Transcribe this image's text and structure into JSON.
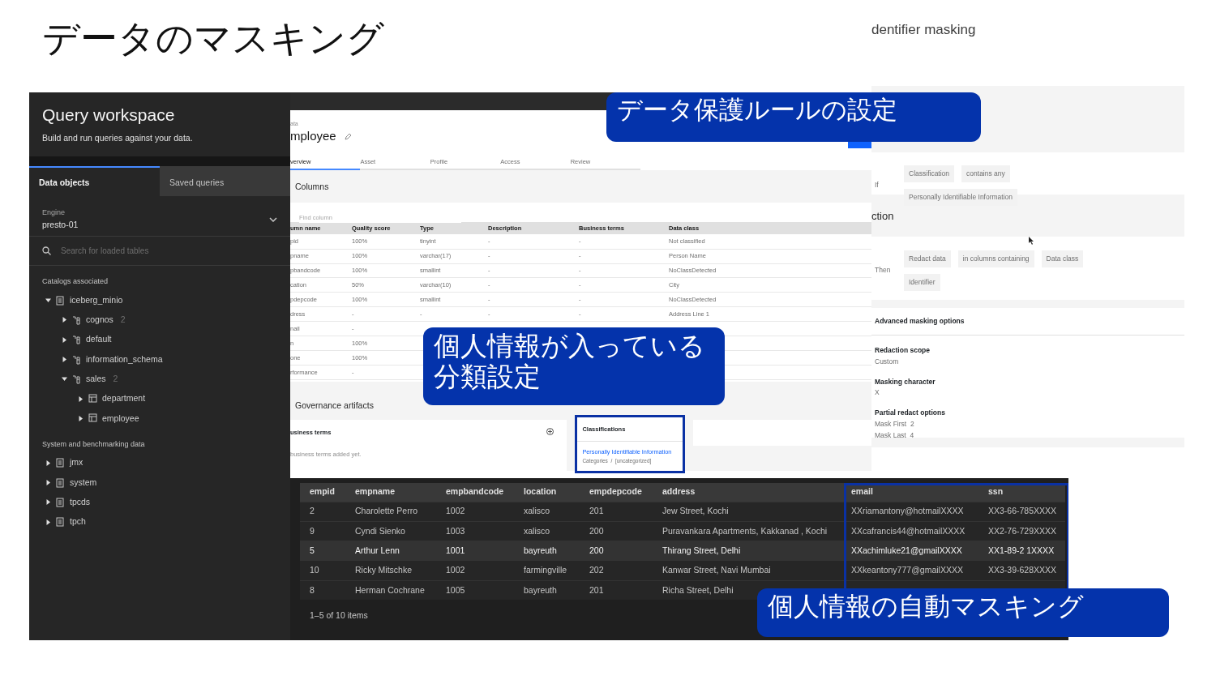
{
  "slide_title": "データのマスキング",
  "query_workspace": {
    "title": "Query workspace",
    "subtitle": "Build and run queries against your data.",
    "tabs": [
      {
        "label": "Data objects",
        "selected": true
      },
      {
        "label": "Saved queries",
        "selected": false
      }
    ],
    "engine_label": "Engine",
    "engine_value": "presto-01",
    "search_placeholder": "Search for loaded tables",
    "sections": [
      {
        "heading": "Catalogs associated",
        "items": [
          {
            "label": "iceberg_minio",
            "kind": "catalog",
            "expanded": true,
            "children": [
              {
                "label": "cognos",
                "count": "2",
                "kind": "schema",
                "expanded": false
              },
              {
                "label": "default",
                "kind": "schema",
                "expanded": false
              },
              {
                "label": "information_schema",
                "kind": "schema",
                "expanded": false
              },
              {
                "label": "sales",
                "count": "2",
                "kind": "schema",
                "expanded": true,
                "children": [
                  {
                    "label": "department",
                    "kind": "table",
                    "expanded": false
                  },
                  {
                    "label": "employee",
                    "kind": "table",
                    "expanded": false
                  }
                ]
              }
            ]
          }
        ]
      },
      {
        "heading": "System and benchmarking data",
        "items": [
          {
            "label": "jmx",
            "kind": "catalog",
            "expanded": false
          },
          {
            "label": "system",
            "kind": "catalog",
            "expanded": false
          },
          {
            "label": "tpcds",
            "kind": "catalog",
            "expanded": false
          },
          {
            "label": "tpch",
            "kind": "catalog",
            "expanded": false
          }
        ]
      }
    ]
  },
  "asset_page": {
    "breadcrumb": "ata",
    "title": "mployee",
    "tabs": [
      {
        "label": "verview",
        "selected": true
      },
      {
        "label": "Asset",
        "selected": false
      },
      {
        "label": "Profile",
        "selected": false
      },
      {
        "label": "Access",
        "selected": false
      },
      {
        "label": "Review",
        "selected": false
      }
    ],
    "columns_heading": "Columns",
    "find_placeholder": "Find column",
    "table": {
      "columns": [
        "umn name",
        "Quality score",
        "Type",
        "Description",
        "Business terms",
        "Data class"
      ],
      "rows": [
        [
          "pid",
          "100%",
          "tinyint",
          "-",
          "-",
          "Not classified"
        ],
        [
          "pname",
          "100%",
          "varchar(17)",
          "-",
          "-",
          "Person Name"
        ],
        [
          "pbandcode",
          "100%",
          "smallint",
          "-",
          "-",
          "NoClassDetected"
        ],
        [
          "cation",
          "50%",
          "varchar(10)",
          "-",
          "-",
          "City"
        ],
        [
          "pdepcode",
          "100%",
          "smallint",
          "-",
          "-",
          "NoClassDetected"
        ],
        [
          "dress",
          "-",
          "-",
          "-",
          "-",
          "Address Line 1"
        ],
        [
          "nail",
          "-"
        ],
        [
          "n",
          "100%"
        ],
        [
          "one",
          "100%"
        ],
        [
          "rformance",
          "-"
        ]
      ]
    },
    "governance_heading": "Governance artifacts",
    "business_terms": {
      "heading": "usiness terms",
      "empty_text": "business terms added yet."
    },
    "classifications": {
      "heading": "Classifications",
      "link": "Personally Identifiable Information",
      "category": "Categories  /  [uncategorized]"
    }
  },
  "rule_page": {
    "title": "dentifier masking",
    "condition": {
      "label": "If",
      "chips": [
        "Classification",
        "contains any",
        "Personally Identifiable Information"
      ]
    },
    "action_heading": "ction",
    "action": {
      "label": "Then",
      "chips": [
        "Redact data",
        "in columns containing",
        "Data class",
        "Identifier"
      ]
    },
    "advanced_heading": "Advanced masking options",
    "options": [
      {
        "label": "Redaction scope",
        "values": [
          "Custom"
        ]
      },
      {
        "label": "Masking character",
        "values": [
          "X"
        ]
      },
      {
        "label": "Partial redact options",
        "values": [
          "Mask First  2",
          "Mask Last  4"
        ]
      }
    ]
  },
  "result_table": {
    "columns": [
      "empid",
      "empname",
      "empbandcode",
      "location",
      "empdepcode",
      "address",
      "email",
      "ssn"
    ],
    "rows": [
      {
        "hovered": false,
        "cells": [
          "2",
          "Charolette Perro",
          "1002",
          "xalisco",
          "201",
          "Jew Street, Kochi",
          "XXriamantony@hotmailXXXX",
          "XX3-66-785XXXX"
        ]
      },
      {
        "hovered": false,
        "cells": [
          "9",
          "Cyndi Sienko",
          "1003",
          "xalisco",
          "200",
          "Puravankara Apartments, Kakkanad , Kochi",
          "XXcafrancis44@hotmailXXXX",
          "XX2-76-729XXXX"
        ]
      },
      {
        "hovered": true,
        "cells": [
          "5",
          "Arthur Lenn",
          "1001",
          "bayreuth",
          "200",
          "Thirang Street, Delhi",
          "XXachimluke21@gmailXXXX",
          "XX1-89-2 1XXXX"
        ]
      },
      {
        "hovered": false,
        "cells": [
          "10",
          "Ricky Mitschke",
          "1002",
          "farmingville",
          "202",
          "Kanwar Street, Navi Mumbai",
          "XXkeantony777@gmailXXXX",
          "XX3-39-628XXXX"
        ]
      },
      {
        "hovered": false,
        "cells": [
          "8",
          "Herman Cochrane",
          "1005",
          "bayreuth",
          "201",
          "Richa Street, Delhi"
        ]
      }
    ],
    "footer": "1–5 of 10 items"
  },
  "callouts": [
    "データ保護ルールの設定",
    "個人情報が入っている分類設定",
    "個人情報の自動マスキング"
  ]
}
